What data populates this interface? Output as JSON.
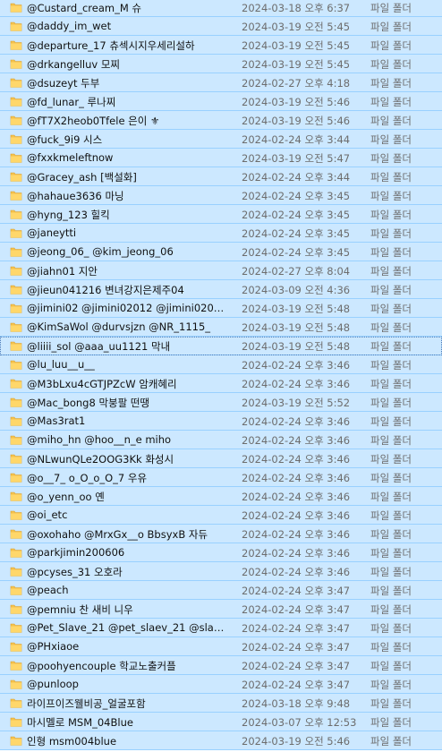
{
  "colors": {
    "selection_bg": "#cce8ff",
    "row_separator": "#99d1ff",
    "folder_icon": "#f4c24d",
    "secondary_text": "#6d6d6d"
  },
  "folder_icon": "folder-icon",
  "rows": [
    {
      "name": "@Custard_cream_M 슈",
      "date": "2024-03-18 오후 6:37",
      "type": "파일 폴더"
    },
    {
      "name": "@daddy_im_wet",
      "date": "2024-03-19 오전 5:45",
      "type": "파일 폴더"
    },
    {
      "name": "@departure_17 츄섹시지우세리설하",
      "date": "2024-03-19 오전 5:45",
      "type": "파일 폴더"
    },
    {
      "name": "@drkangelluv 모찌",
      "date": "2024-03-19 오전 5:45",
      "type": "파일 폴더"
    },
    {
      "name": "@dsuzeyt 두부",
      "date": "2024-02-27 오후 4:18",
      "type": "파일 폴더"
    },
    {
      "name": "@fd_lunar_ 루나찌",
      "date": "2024-03-19 오전 5:46",
      "type": "파일 폴더"
    },
    {
      "name": "@fT7X2heob0Tfele 은이 ⚜",
      "date": "2024-03-19 오전 5:46",
      "type": "파일 폴더"
    },
    {
      "name": "@fuck_9i9 시스",
      "date": "2024-02-24 오후 3:44",
      "type": "파일 폴더"
    },
    {
      "name": "@fxxkmeleftnow",
      "date": "2024-03-19 오전 5:47",
      "type": "파일 폴더"
    },
    {
      "name": "@Gracey_ash [백설화]",
      "date": "2024-02-24 오후 3:44",
      "type": "파일 폴더"
    },
    {
      "name": "@hahaue3636 마닝",
      "date": "2024-02-24 오후 3:45",
      "type": "파일 폴더"
    },
    {
      "name": "@hyng_123 힐킥",
      "date": "2024-02-24 오후 3:45",
      "type": "파일 폴더"
    },
    {
      "name": "@janeytti",
      "date": "2024-02-24 오후 3:45",
      "type": "파일 폴더"
    },
    {
      "name": "@jeong_06_ @kim_jeong_06",
      "date": "2024-02-24 오후 3:45",
      "type": "파일 폴더"
    },
    {
      "name": "@jiahn01 지안",
      "date": "2024-02-27 오후 8:04",
      "type": "파일 폴더"
    },
    {
      "name": "@jieun041216 변녀강지은제주04",
      "date": "2024-03-09 오전 4:36",
      "type": "파일 폴더"
    },
    {
      "name": "@jimini02 @jimini02012 @jimini0201 ...",
      "date": "2024-03-19 오전 5:48",
      "type": "파일 폴더"
    },
    {
      "name": "@KimSaWol @durvsjzn @NR_1115_",
      "date": "2024-03-19 오전 5:48",
      "type": "파일 폴더"
    },
    {
      "name": "@liiii_sol @aaa_uu1121 막내",
      "date": "2024-03-19 오전 5:48",
      "type": "파일 폴더"
    },
    {
      "name": "@lu_luu__u__",
      "date": "2024-02-24 오후 3:46",
      "type": "파일 폴더"
    },
    {
      "name": "@M3bLxu4cGTJPZcW 암캐혜리",
      "date": "2024-02-24 오후 3:46",
      "type": "파일 폴더"
    },
    {
      "name": "@Mac_bong8 막붕팔 떤땡",
      "date": "2024-03-19 오전 5:52",
      "type": "파일 폴더"
    },
    {
      "name": "@Mas3rat1",
      "date": "2024-02-24 오후 3:46",
      "type": "파일 폴더"
    },
    {
      "name": "@miho_hn @hoo__n_e miho",
      "date": "2024-02-24 오후 3:46",
      "type": "파일 폴더"
    },
    {
      "name": "@NLwunQLe2OOG3Kk 화성시",
      "date": "2024-02-24 오후 3:46",
      "type": "파일 폴더"
    },
    {
      "name": "@o__7_ o_O_o_O_7 우유",
      "date": "2024-02-24 오후 3:46",
      "type": "파일 폴더"
    },
    {
      "name": "@o_yenn_oo 옌",
      "date": "2024-02-24 오후 3:46",
      "type": "파일 폴더"
    },
    {
      "name": "@oi_etc",
      "date": "2024-02-24 오후 3:46",
      "type": "파일 폴더"
    },
    {
      "name": "@oxohaho @MrxGx__o BbsyxB  자듀",
      "date": "2024-02-24 오후 3:46",
      "type": "파일 폴더"
    },
    {
      "name": "@parkjimin200606",
      "date": "2024-02-24 오후 3:46",
      "type": "파일 폴더"
    },
    {
      "name": "@pcyses_31 오호라",
      "date": "2024-02-24 오후 3:46",
      "type": "파일 폴더"
    },
    {
      "name": "@peach",
      "date": "2024-02-24 오후 3:47",
      "type": "파일 폴더"
    },
    {
      "name": "@pemniu 찬 새비 니우",
      "date": "2024-02-24 오후 3:47",
      "type": "파일 폴더"
    },
    {
      "name": "@Pet_Slave_21 @pet_slaev_21 @slaev s...",
      "date": "2024-02-24 오후 3:47",
      "type": "파일 폴더"
    },
    {
      "name": "@PHxiaoe",
      "date": "2024-02-24 오후 3:47",
      "type": "파일 폴더"
    },
    {
      "name": "@poohyencouple 학교노출커플",
      "date": "2024-02-24 오후 3:47",
      "type": "파일 폴더"
    },
    {
      "name": "@punloop",
      "date": "2024-02-24 오후 3:47",
      "type": "파일 폴더"
    },
    {
      "name": "라이프이즈웰비공_얼굴포함",
      "date": "2024-03-18 오후 9:48",
      "type": "파일 폴더"
    },
    {
      "name": "마시멜로 MSM_04Blue",
      "date": "2024-03-07 오후 12:53",
      "type": "파일 폴더"
    },
    {
      "name": "인형 msm004blue",
      "date": "2024-03-19 오전 5:46",
      "type": "파일 폴더"
    }
  ]
}
